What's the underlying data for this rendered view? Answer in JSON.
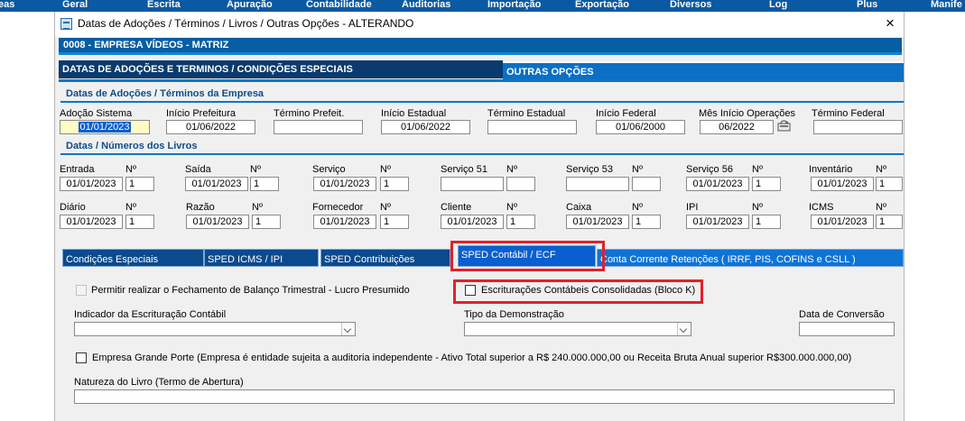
{
  "menubar": [
    "eas",
    "Geral",
    "Escrita",
    "Apuração",
    "Contabilidade",
    "Auditorias",
    "Importação",
    "Exportação",
    "Diversos",
    "Log",
    "Plus",
    "Manife"
  ],
  "window": {
    "title": "Datas de Adoções / Términos / Livros / Outras Opções  -  ALTERANDO",
    "close": "×"
  },
  "company": "0008   -   EMPRESA VÍDEOS - MATRIZ",
  "tabs": {
    "main": "DATAS DE ADOÇÕES E TERMINOS / CONDIÇÕES ESPECIAIS",
    "other": "OUTRAS OPÇÕES"
  },
  "adocoes": {
    "section": "Datas de Adoções / Términos da Empresa",
    "fields": [
      {
        "label": "Adoção Sistema",
        "value": "01/01/2023"
      },
      {
        "label": "Início Prefeitura",
        "value": "01/06/2022"
      },
      {
        "label": "Término Prefeit.",
        "value": ""
      },
      {
        "label": "Início Estadual",
        "value": "01/06/2022"
      },
      {
        "label": "Término Estadual",
        "value": ""
      },
      {
        "label": "Início Federal",
        "value": "01/06/2000"
      },
      {
        "label": "Mês Início Operações",
        "value": "06/2022"
      },
      {
        "label": "Término Federal",
        "value": ""
      }
    ]
  },
  "livros": {
    "section": "Datas / Números dos Livros",
    "num_label": "Nº",
    "row1": [
      {
        "label": "Entrada",
        "date": "01/01/2023",
        "num": "1"
      },
      {
        "label": "Saída",
        "date": "01/01/2023",
        "num": "1"
      },
      {
        "label": "Serviço",
        "date": "01/01/2023",
        "num": "1"
      },
      {
        "label": "Serviço 51",
        "date": "",
        "num": ""
      },
      {
        "label": "Serviço 53",
        "date": "",
        "num": ""
      },
      {
        "label": "Serviço 56",
        "date": "01/01/2023",
        "num": "1"
      },
      {
        "label": "Inventário",
        "date": "01/01/2023",
        "num": "1"
      }
    ],
    "row2": [
      {
        "label": "Diário",
        "date": "01/01/2023",
        "num": "1"
      },
      {
        "label": "Razão",
        "date": "01/01/2023",
        "num": "1"
      },
      {
        "label": "Fornecedor",
        "date": "01/01/2023",
        "num": "1"
      },
      {
        "label": "Cliente",
        "date": "01/01/2023",
        "num": "1"
      },
      {
        "label": "Caixa",
        "date": "01/01/2023",
        "num": "1"
      },
      {
        "label": "IPI",
        "date": "01/01/2023",
        "num": "1"
      },
      {
        "label": "ICMS",
        "date": "01/01/2023",
        "num": "1"
      }
    ]
  },
  "subtabs": [
    "Condições Especiais",
    "SPED ICMS / IPI",
    "SPED Contribuições",
    "SPED Contábil / ECF",
    "Conta Corrente Retenções ( IRRF,  PIS,  COFINS  e  CSLL )"
  ],
  "sped": {
    "balanco": "Permitir realizar o Fechamento de Balanço Trimestral - Lucro Presumido",
    "consolidadas": "Escriturações Contábeis Consolidadas (Bloco K)",
    "indicador_label": "Indicador da Escrituração Contábil",
    "indicador_value": "",
    "tipo_label": "Tipo da Demonstração",
    "tipo_value": "",
    "conversao_label": "Data de Conversão",
    "conversao_value": "",
    "grande_porte": "Empresa Grande Porte (Empresa é entidade sujeita a auditoria independente - Ativo Total superior a R$ 240.000.000,00 ou Receita Bruta Anual superior R$300.000.000,00)",
    "natureza_label": "Natureza do Livro (Termo de Abertura)",
    "natureza_value": ""
  },
  "colors": {
    "menubar": "#0a59a3",
    "header": "#075ea3",
    "highlight": "#e3202b"
  }
}
